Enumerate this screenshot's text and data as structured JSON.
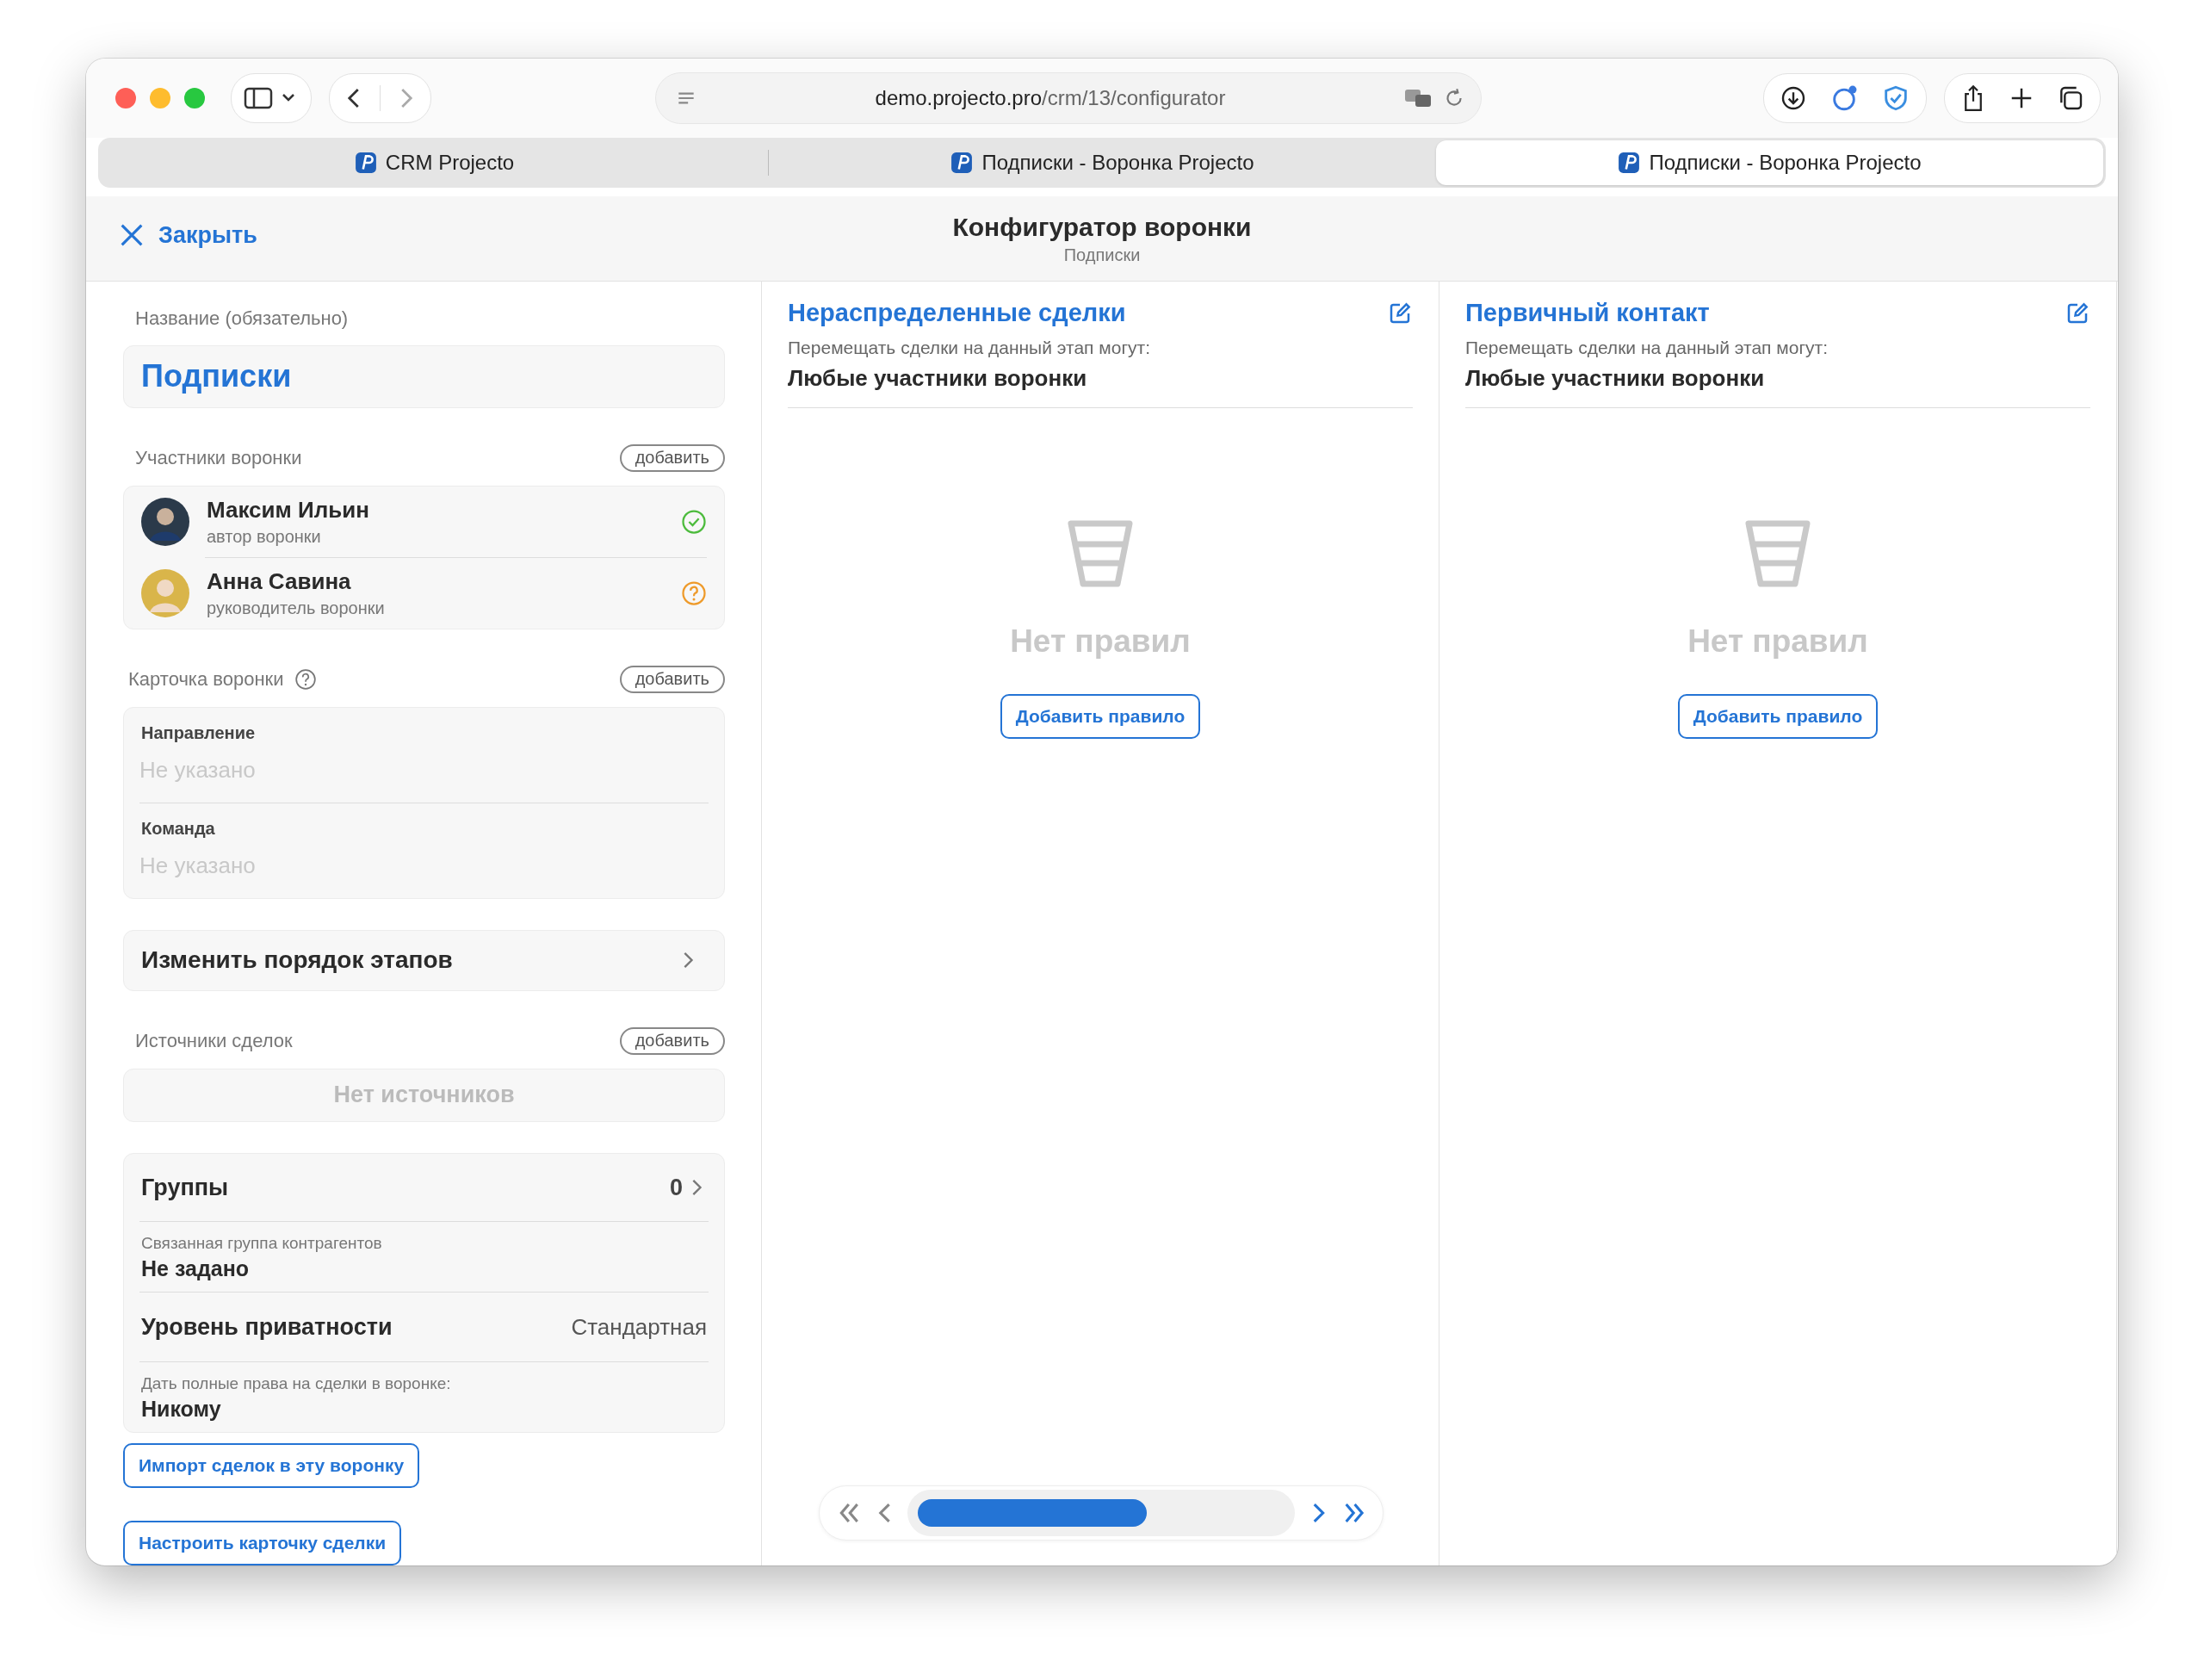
{
  "browser": {
    "url_host": "demo.projecto.pro",
    "url_path": "/crm/13/configurator",
    "back_disabled": false,
    "forward_disabled": true,
    "tabs": [
      {
        "title": "CRM Projecto",
        "selected": false
      },
      {
        "title": "Подписки - Воронка Projecto",
        "selected": false
      },
      {
        "title": "Подписки - Воронка Projecto",
        "selected": true
      }
    ]
  },
  "header": {
    "close": "Закрыть",
    "title": "Конфигуратор воронки",
    "subtitle": "Подписки"
  },
  "name_field": {
    "label": "Название (обязательно)",
    "value": "Подписки"
  },
  "members": {
    "heading": "Участники воронки",
    "add": "добавить",
    "items": [
      {
        "name": "Максим Ильин",
        "role": "автор воронки",
        "confirmed": true
      },
      {
        "name": "Анна Савина",
        "role": "руководитель воронки",
        "confirmed": false
      }
    ]
  },
  "funnel_card": {
    "heading": "Карточка воронки",
    "add": "добавить",
    "fields": [
      {
        "label": "Направление",
        "placeholder": "Не указано"
      },
      {
        "label": "Команда",
        "placeholder": "Не указано"
      }
    ]
  },
  "reorder": "Изменить порядок этапов",
  "sources": {
    "heading": "Источники сделок",
    "add": "добавить",
    "empty": "Нет источников"
  },
  "settings": {
    "groups_label": "Группы",
    "groups_count": "0",
    "linked_group_label": "Связанная группа контрагентов",
    "linked_group_value": "Не задано",
    "privacy_label": "Уровень приватности",
    "privacy_value": "Стандартная",
    "rights_label": "Дать полные права на сделки в воронке:",
    "rights_value": "Никому"
  },
  "actions": [
    "Импорт сделок в эту воронку",
    "Настроить карточку сделки"
  ],
  "stages": [
    {
      "title": "Нераспределенные сделки",
      "movers_label": "Перемещать сделки на данный этап могут:",
      "movers_value": "Любые участники воронки",
      "empty": "Нет правил",
      "add_rule": "Добавить правило"
    },
    {
      "title": "Первичный контакт",
      "movers_label": "Перемещать сделки на данный этап могут:",
      "movers_value": "Любые участники воронки",
      "empty": "Нет правил",
      "add_rule": "Добавить правило"
    }
  ],
  "pager": [
    {
      "kind": "first",
      "disabled": true
    },
    {
      "kind": "prev",
      "disabled": true
    },
    {
      "kind": "next",
      "disabled": false
    },
    {
      "kind": "last",
      "disabled": false
    }
  ]
}
